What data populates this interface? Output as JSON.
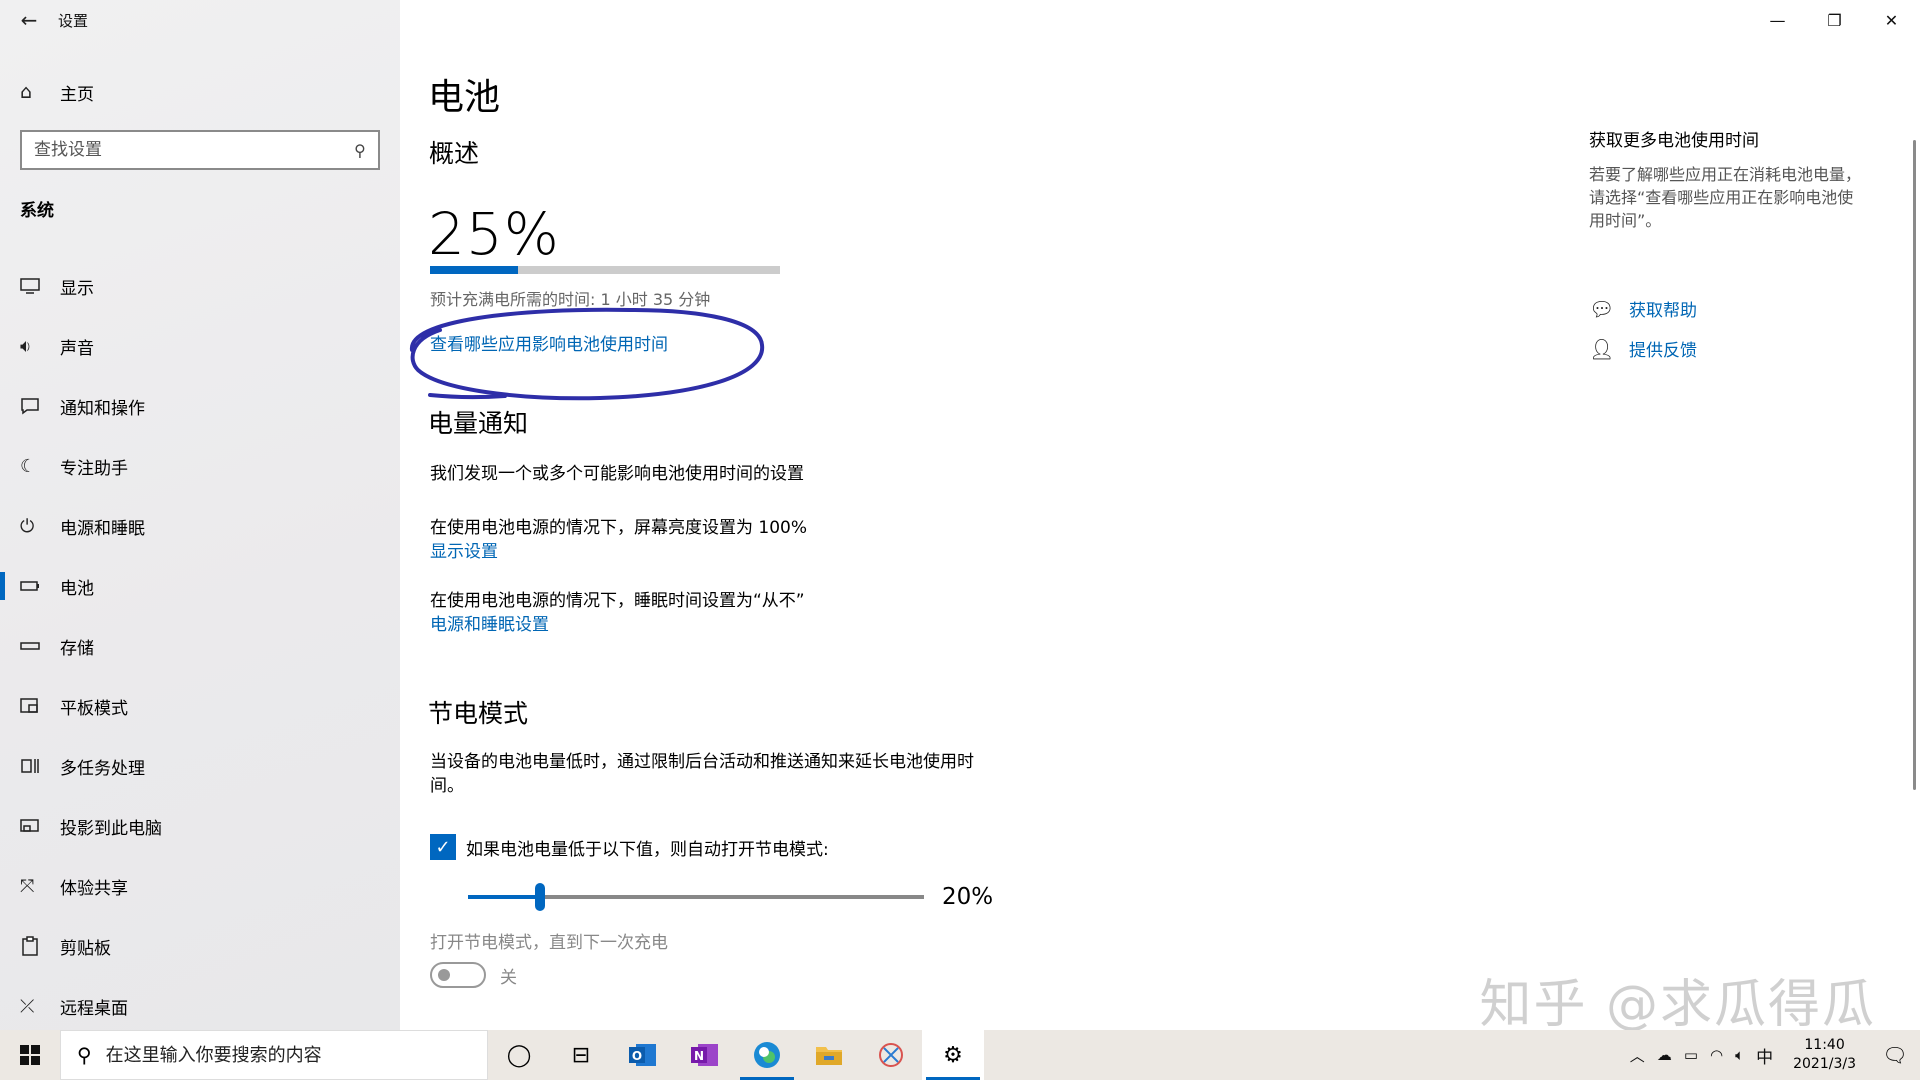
{
  "window": {
    "title": "设置",
    "minimize": "—",
    "restore": "❐",
    "close": "✕"
  },
  "sidebar": {
    "home": "主页",
    "search_placeholder": "查找设置",
    "section": "系统",
    "items": [
      {
        "label": "显示",
        "icon": "monitor-icon"
      },
      {
        "label": "声音",
        "icon": "speaker-icon"
      },
      {
        "label": "通知和操作",
        "icon": "notification-icon"
      },
      {
        "label": "专注助手",
        "icon": "moon-icon"
      },
      {
        "label": "电源和睡眠",
        "icon": "power-icon"
      },
      {
        "label": "电池",
        "icon": "battery-icon",
        "active": true
      },
      {
        "label": "存储",
        "icon": "storage-icon"
      },
      {
        "label": "平板模式",
        "icon": "tablet-icon"
      },
      {
        "label": "多任务处理",
        "icon": "multitask-icon"
      },
      {
        "label": "投影到此电脑",
        "icon": "project-icon"
      },
      {
        "label": "体验共享",
        "icon": "share-icon"
      },
      {
        "label": "剪贴板",
        "icon": "clipboard-icon"
      },
      {
        "label": "远程桌面",
        "icon": "remote-icon"
      }
    ]
  },
  "main": {
    "title": "电池",
    "overview": {
      "heading": "概述",
      "percent_text": "25%",
      "percent_value": 25,
      "charge_time": "预计充满电所需的时间: 1 小时 35 分钟",
      "apps_link": "查看哪些应用影响电池使用时间"
    },
    "notifications": {
      "heading": "电量通知",
      "intro": "我们发现一个或多个可能影响电池使用时间的设置",
      "item1_text": "在使用电池电源的情况下，屏幕亮度设置为 100%",
      "item1_link": "显示设置",
      "item2_text": "在使用电池电源的情况下，睡眠时间设置为“从不”",
      "item2_link": "电源和睡眠设置"
    },
    "saver": {
      "heading": "节电模式",
      "desc_line1": "当设备的电池电量低时，通过限制后台活动和推送通知来延长电池使用时",
      "desc_line2": "间。",
      "checkbox_label": "如果电池电量低于以下值，则自动打开节电模式:",
      "checkbox_checked": true,
      "slider_text": "20%",
      "slider_value": 20,
      "until_next": "打开节电模式，直到下一次充电",
      "toggle_state": "关"
    },
    "side": {
      "title": "获取更多电池使用时间",
      "desc_line1": "若要了解哪些应用正在消耗电池电量，",
      "desc_line2": "请选择“查看哪些应用正在影响电池使",
      "desc_line3": "用时间”。",
      "help": "获取帮助",
      "feedback": "提供反馈"
    }
  },
  "watermark": "知乎 @求瓜得瓜",
  "taskbar": {
    "search_placeholder": "在这里输入你要搜索的内容",
    "ime": "中",
    "time": "11:40",
    "date": "2021/3/3"
  },
  "colors": {
    "accent": "#0067c0",
    "link": "#0066b4",
    "annotation": "#2e2ea8"
  }
}
